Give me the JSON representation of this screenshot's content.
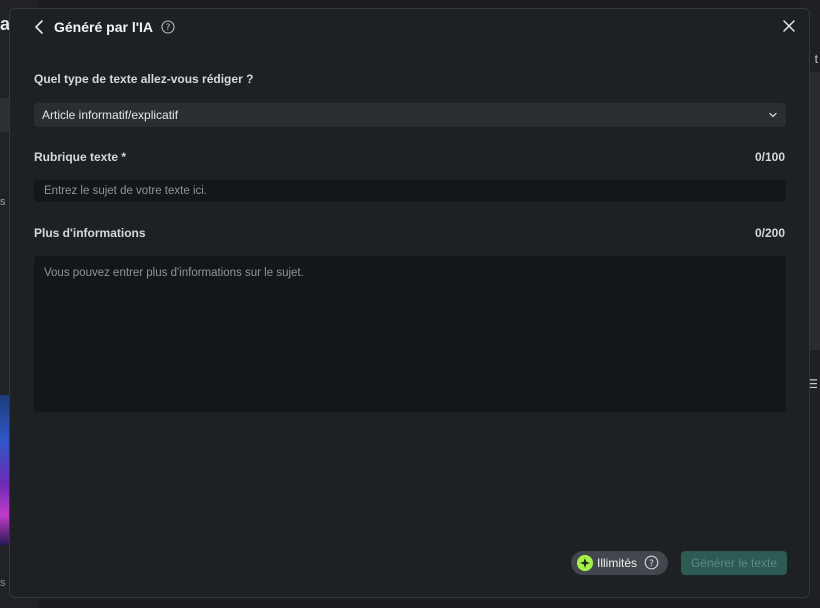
{
  "background": {
    "left_fragment": "a",
    "left_fragment2": "s",
    "left_fragment3": "s",
    "right_fragment": "t",
    "right_icon": "list-icon"
  },
  "dialog": {
    "title": "Généré par l'IA",
    "type_label": "Quel type de texte allez-vous rédiger ?",
    "type_value": "Article informatif/explicatif",
    "topic_label": "Rubrique texte *",
    "topic_counter": "0/100",
    "topic_placeholder": "Entrez le sujet de votre texte ici.",
    "more_label": "Plus d'informations",
    "more_counter": "0/200",
    "more_placeholder": "Vous pouvez entrer plus d'informations sur le sujet.",
    "badge_label": "Illimités",
    "generate_label": "Générer le texte"
  },
  "colors": {
    "accent_green": "#a6f04a",
    "button_bg": "#2d5b53"
  }
}
